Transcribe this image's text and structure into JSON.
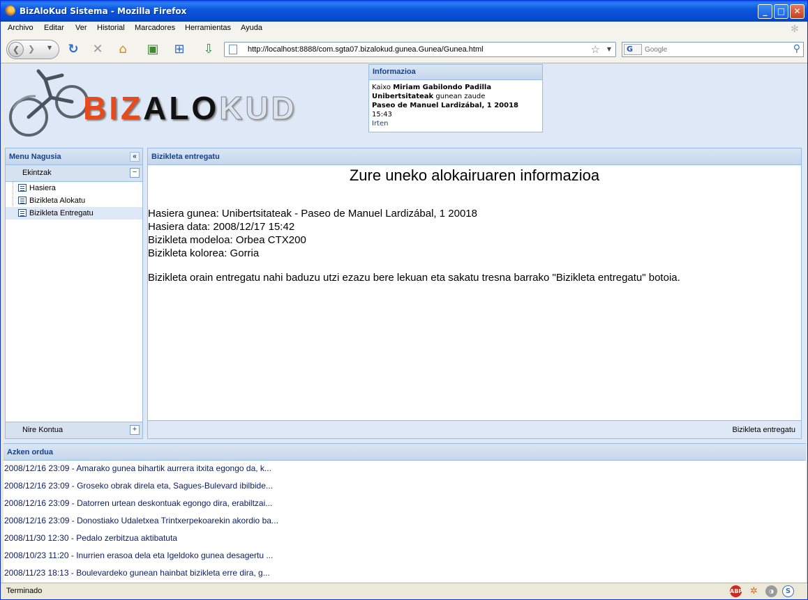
{
  "window": {
    "title": "BizAloKud Sistema - Mozilla Firefox"
  },
  "menubar": [
    "Archivo",
    "Editar",
    "Ver",
    "Historial",
    "Marcadores",
    "Herramientas",
    "Ayuda"
  ],
  "navbar": {
    "url": "http://localhost:8888/com.sgta07.bizalokud.gunea.Gunea/Gunea.html",
    "search_placeholder": "Google",
    "search_engine_glyph": "G"
  },
  "logo": {
    "part1": "BIZ",
    "part2": "ALO",
    "part3": "KUD"
  },
  "info": {
    "title": "Informazioa",
    "greeting": "Kaixo",
    "user": "Miriam Gabilondo Padilla",
    "station": "Unibertsitateak",
    "station_suffix": "gunean zaude",
    "address": "Paseo de Manuel Lardizábal, 1 20018",
    "time": "15:43",
    "logout": "Irten"
  },
  "menu": {
    "title": "Menu Nagusia",
    "section": "Ekintzak",
    "items": [
      "Hasiera",
      "Bizikleta Alokatu",
      "Bizikleta Entregatu"
    ],
    "selected_index": 2,
    "footer": "Nire Kontua"
  },
  "main": {
    "title": "Bizikleta entregatu",
    "heading": "Zure uneko alokairuaren informazioa",
    "details": [
      "Hasiera gunea: Unibertsitateak - Paseo de Manuel Lardizábal, 1 20018",
      "Hasiera data: 2008/12/17 15:42",
      "Bizikleta modeloa: Orbea CTX200",
      "Bizikleta kolorea: Gorria"
    ],
    "note": "Bizikleta orain entregatu nahi baduzu utzi ezazu bere lekuan eta sakatu tresna barrako \"Bizikleta entregatu\" botoia.",
    "footer_button": "Bizikleta entregatu"
  },
  "news": {
    "title": "Azken ordua",
    "items": [
      "2008/12/16 23:09 - Amarako gunea bihartik aurrera itxita egongo da, k...",
      "2008/12/16 23:09 - Groseko obrak direla eta, Sagues-Bulevard ibilbide...",
      "2008/12/16 23:09 - Datorren urtean deskontuak egongo dira, erabiltzai...",
      "2008/12/16 23:09 - Donostiako Udaletxea Trintxerpekoarekin akordio ba...",
      "2008/11/30 12:30 - Pedalo zerbitzua aktibatuta",
      "2008/10/23 11:20 - Inurrien erasoa dela eta Igeldoko gunea desagertu ...",
      "2008/11/23 18:13 - Boulevardeko gunean hainbat bizikleta erre dira, g..."
    ]
  },
  "status": {
    "text": "Terminado",
    "abp": "ABP",
    "s": "S"
  },
  "colors": {
    "panel_title": "#15428b",
    "panel_border": "#99bbe8",
    "panel_bg": "#dfe8f6",
    "logo_red": "#e84a1c"
  }
}
